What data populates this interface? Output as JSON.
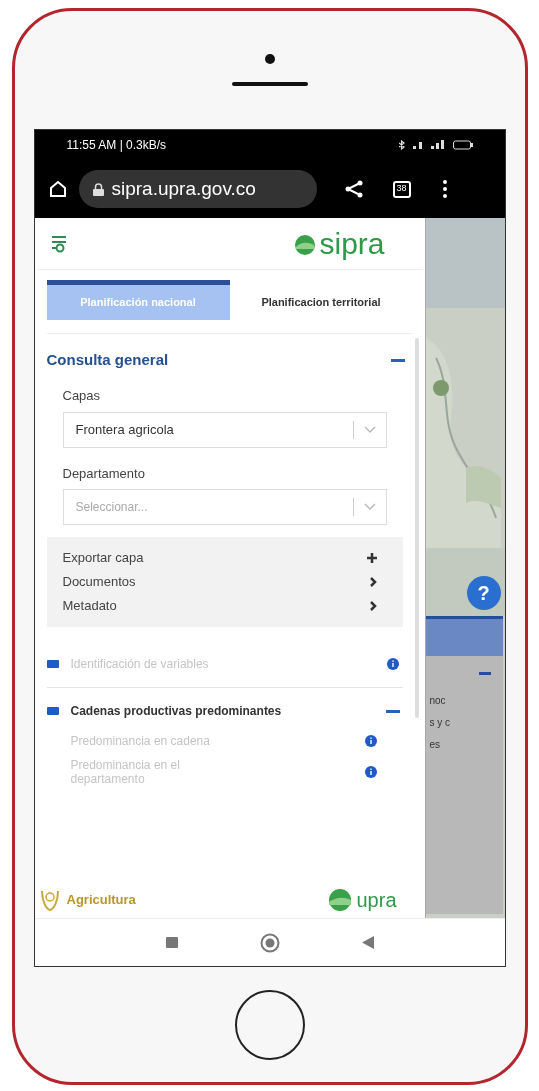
{
  "status_bar": {
    "time": "11:55 AM | 0.3kB/s"
  },
  "browser": {
    "url": "sipra.upra.gov.co",
    "tab_count": "38"
  },
  "header": {
    "logo": "sipra"
  },
  "tabs": [
    {
      "label": "Planificación nacional",
      "selected": true
    },
    {
      "label": "Planificacion territorial",
      "selected": false
    }
  ],
  "section": {
    "title": "Consulta general",
    "expanded": true,
    "fields": [
      {
        "label": "Capas",
        "value": "Frontera agricola"
      },
      {
        "label": "Departamento",
        "placeholder": "Seleccionar..."
      }
    ],
    "actions": [
      {
        "label": "Exportar capa",
        "kind": "expand"
      },
      {
        "label": "Documentos",
        "kind": "link"
      },
      {
        "label": "Metadato",
        "kind": "link"
      }
    ]
  },
  "layers": [
    {
      "title": "Identificación de variables",
      "expanded": false,
      "disabled": true
    },
    {
      "title": "Cadenas productivas predominantes",
      "expanded": true,
      "disabled": false,
      "children": [
        {
          "label": "Predominancia en cadena"
        },
        {
          "label": "Predominancia en el departamento"
        }
      ]
    }
  ],
  "footer": {
    "left": "Agricultura",
    "right": "upra"
  },
  "map": {
    "help": "?",
    "panel_lines": [
      "noc",
      "s y c",
      "es"
    ]
  }
}
